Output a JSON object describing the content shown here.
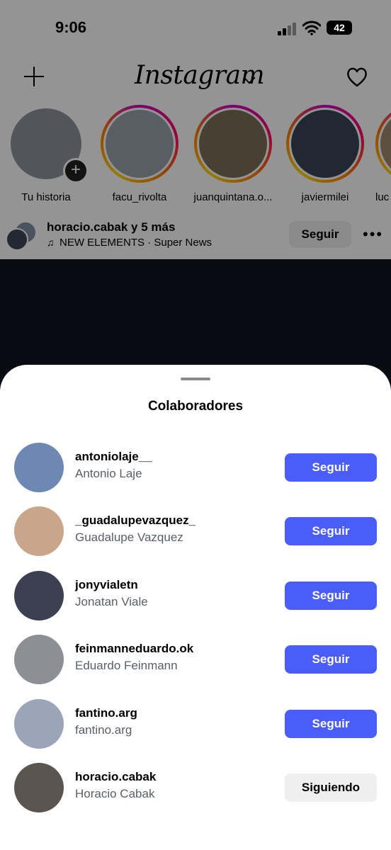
{
  "status": {
    "time": "9:06",
    "battery": "42"
  },
  "header": {
    "logo": "Instagram"
  },
  "stories": [
    {
      "name": "Tu historia",
      "color": "#8e939b"
    },
    {
      "name": "facu_rivolta",
      "color": "#9aa3ad"
    },
    {
      "name": "juanquintana.o...",
      "color": "#7b6f58"
    },
    {
      "name": "javiermilei",
      "color": "#3a4657"
    },
    {
      "name": "luc",
      "color": "#a08870"
    }
  ],
  "post": {
    "user": "horacio.cabak y 5 más",
    "audio": "NEW ELEMENTS · Super News",
    "follow_label": "Seguir"
  },
  "sheet": {
    "title": "Colaboradores",
    "rows": [
      {
        "username": "antoniolaje__",
        "fullname": "Antonio Laje",
        "button": "Seguir",
        "following": false,
        "avatar_color": "#6d89b3"
      },
      {
        "username": "_guadalupevazquez_",
        "fullname": "Guadalupe Vazquez",
        "button": "Seguir",
        "following": false,
        "avatar_color": "#c9a58a"
      },
      {
        "username": "jonyvialetn",
        "fullname": "Jonatan Viale",
        "button": "Seguir",
        "following": false,
        "avatar_color": "#3c4152"
      },
      {
        "username": "feinmanneduardo.ok",
        "fullname": "Eduardo Feinmann",
        "button": "Seguir",
        "following": false,
        "avatar_color": "#8c8f94"
      },
      {
        "username": "fantino.arg",
        "fullname": "fantino.arg",
        "button": "Seguir",
        "following": false,
        "avatar_color": "#9aa5b8"
      },
      {
        "username": "horacio.cabak",
        "fullname": "Horacio Cabak",
        "button": "Siguiendo",
        "following": true,
        "avatar_color": "#5b5550"
      }
    ]
  },
  "colors": {
    "accent": "#4a5df9",
    "secondary_text": "#5a5f66"
  }
}
